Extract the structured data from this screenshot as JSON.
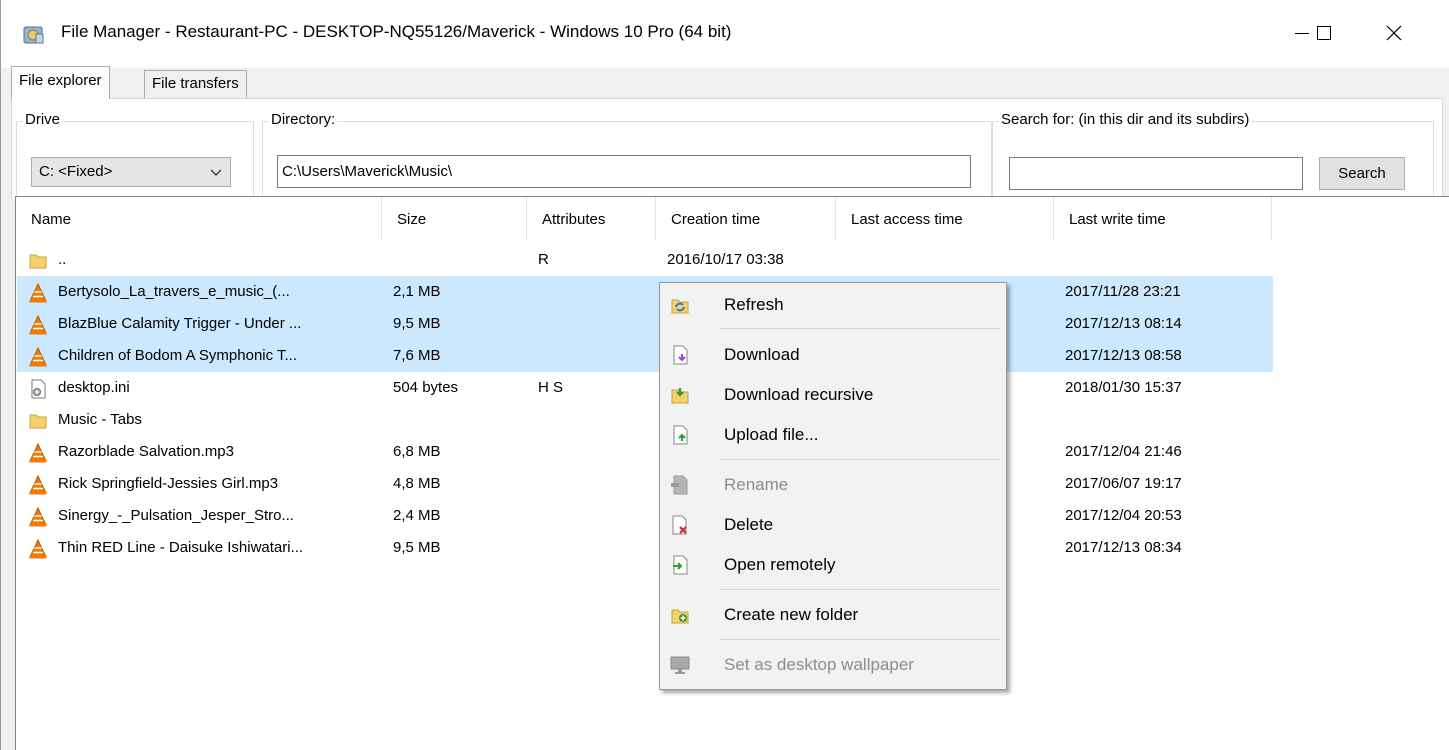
{
  "window": {
    "title": "File Manager - Restaurant-PC - DESKTOP-NQ55126/Maverick - Windows 10 Pro (64 bit)",
    "controls": [
      "minimize",
      "maximize",
      "close"
    ]
  },
  "tabs": [
    {
      "label": "File explorer",
      "active": true
    },
    {
      "label": "File transfers",
      "active": false
    }
  ],
  "drive": {
    "legend": "Drive",
    "value": "C: <Fixed>"
  },
  "directory": {
    "legend": "Directory:",
    "value": "C:\\Users\\Maverick\\Music\\"
  },
  "search": {
    "legend": "Search for: (in this dir and its subdirs)",
    "value": "",
    "button": "Search"
  },
  "columns": [
    "Name",
    "Size",
    "Attributes",
    "Creation time",
    "Last access time",
    "Last write time"
  ],
  "files": [
    {
      "name": "..",
      "size": "",
      "attributes": "R",
      "creation": "2016/10/17 03:38",
      "last_access": "",
      "last_write": "",
      "icon": "folder-icon",
      "selected": false
    },
    {
      "name": "Bertysolo_La_travers_e_music_(...",
      "size": "2,1 MB",
      "attributes": "",
      "creation": "",
      "last_access": "",
      "last_write": "2017/11/28 23:21",
      "icon": "vlc-icon",
      "selected": true
    },
    {
      "name": "BlazBlue Calamity Trigger - Under ...",
      "size": "9,5 MB",
      "attributes": "",
      "creation": "",
      "last_access": "",
      "last_write": "2017/12/13 08:14",
      "icon": "vlc-icon",
      "selected": true
    },
    {
      "name": "Children of Bodom A Symphonic T...",
      "size": "7,6 MB",
      "attributes": "",
      "creation": "",
      "last_access": "",
      "last_write": "2017/12/13 08:58",
      "icon": "vlc-icon",
      "selected": true
    },
    {
      "name": "desktop.ini",
      "size": "504  bytes",
      "attributes": "H S",
      "creation": "",
      "last_access": "",
      "last_write": "2018/01/30 15:37",
      "icon": "settings-file-icon",
      "selected": false
    },
    {
      "name": "Music - Tabs",
      "size": "",
      "attributes": "",
      "creation": "",
      "last_access": "",
      "last_write": "",
      "icon": "folder-icon",
      "selected": false
    },
    {
      "name": "Razorblade Salvation.mp3",
      "size": "6,8 MB",
      "attributes": "",
      "creation": "",
      "last_access": "",
      "last_write": "2017/12/04 21:46",
      "icon": "vlc-icon",
      "selected": false
    },
    {
      "name": "Rick Springfield-Jessies Girl.mp3",
      "size": "4,8 MB",
      "attributes": "",
      "creation": "",
      "last_access": "",
      "last_write": "2017/06/07 19:17",
      "icon": "vlc-icon",
      "selected": false
    },
    {
      "name": "Sinergy_-_Pulsation_Jesper_Stro...",
      "size": "2,4 MB",
      "attributes": "",
      "creation": "",
      "last_access": "",
      "last_write": "2017/12/04 20:53",
      "icon": "vlc-icon",
      "selected": false
    },
    {
      "name": "Thin RED Line - Daisuke Ishiwatari...",
      "size": "9,5 MB",
      "attributes": "",
      "creation": "",
      "last_access": "",
      "last_write": "2017/12/13 08:34",
      "icon": "vlc-icon",
      "selected": false
    }
  ],
  "context_menu": [
    {
      "label": "Refresh",
      "icon": "refresh-icon",
      "enabled": true
    },
    {
      "separator": true
    },
    {
      "label": "Download",
      "icon": "download-icon",
      "enabled": true
    },
    {
      "label": "Download recursive",
      "icon": "download-recursive-icon",
      "enabled": true
    },
    {
      "label": "Upload file...",
      "icon": "upload-icon",
      "enabled": true
    },
    {
      "separator": true
    },
    {
      "label": "Rename",
      "icon": "rename-icon",
      "enabled": false
    },
    {
      "label": "Delete",
      "icon": "delete-icon",
      "enabled": true
    },
    {
      "label": "Open remotely",
      "icon": "open-remotely-icon",
      "enabled": true
    },
    {
      "separator": true
    },
    {
      "label": "Create new folder",
      "icon": "new-folder-icon",
      "enabled": true
    },
    {
      "separator": true
    },
    {
      "label": "Set as desktop wallpaper",
      "icon": "wallpaper-icon",
      "enabled": false
    }
  ],
  "colors": {
    "selection": "#cce8ff",
    "folder": "#f5d06b",
    "vlc_orange": "#f27b00",
    "disabled_text": "#8c8c8c"
  }
}
